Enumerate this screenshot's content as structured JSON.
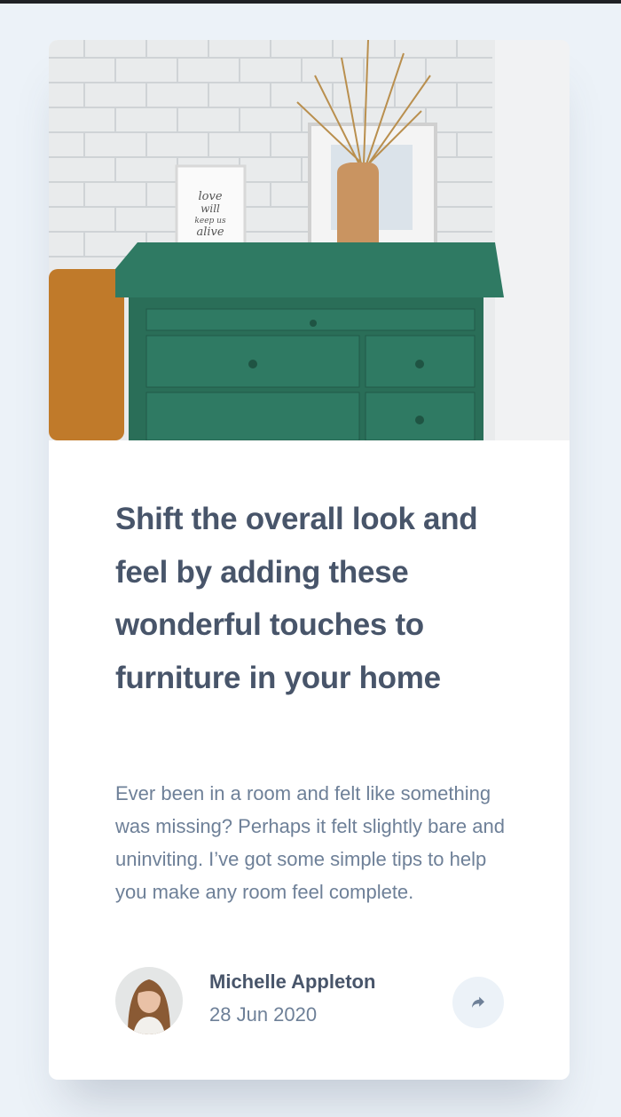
{
  "article": {
    "title": "Shift the overall look and feel by adding these wonderful touches to furniture in your home",
    "description": "Ever been in a room and felt like something was missing? Perhaps it felt slightly bare and uninviting. I’ve got some simple tips to help you make any room feel complete.",
    "image_frame_lettering": [
      "love",
      "will",
      "keep us",
      "alive"
    ]
  },
  "author": {
    "name": "Michelle Appleton",
    "date": "28 Jun 2020"
  },
  "icons": {
    "share": "share-icon"
  },
  "colors": {
    "background": "#ecf2f8",
    "heading": "#48556a",
    "body": "#6e8098",
    "drawer": "#2f7a63"
  }
}
